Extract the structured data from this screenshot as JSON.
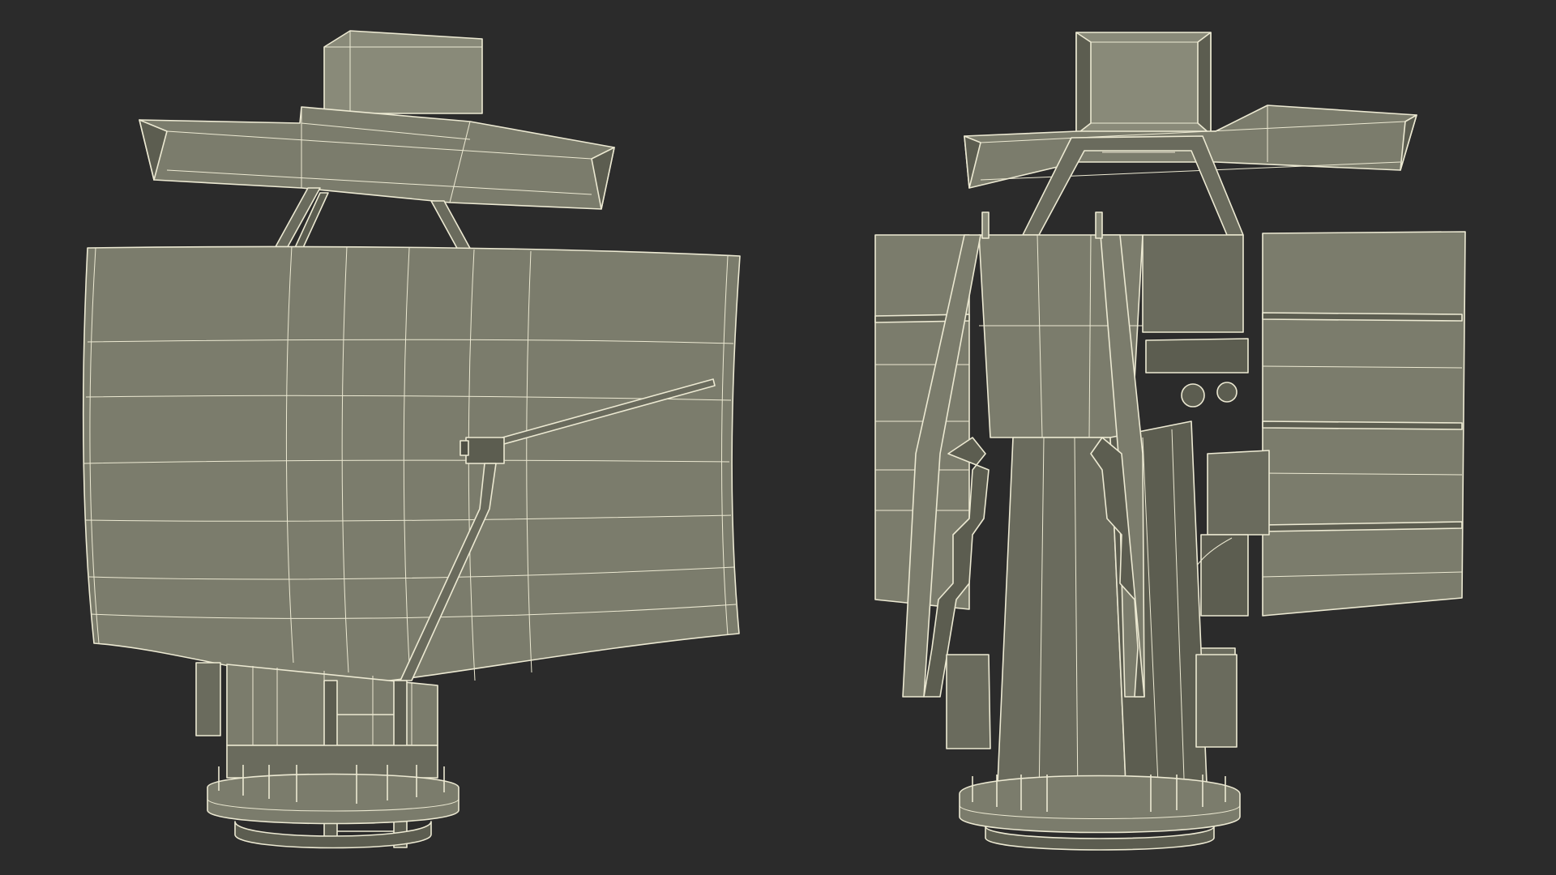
{
  "colors": {
    "background": "#2b2b2b",
    "wire": "#ece9d2",
    "surface_light": "#898a79",
    "surface_mid": "#7b7c6c",
    "surface_dark": "#5c5d50",
    "surface_shadow": "#4f5045"
  },
  "views": [
    {
      "id": "front",
      "description_visible": false
    },
    {
      "id": "rear",
      "description_visible": false
    }
  ]
}
